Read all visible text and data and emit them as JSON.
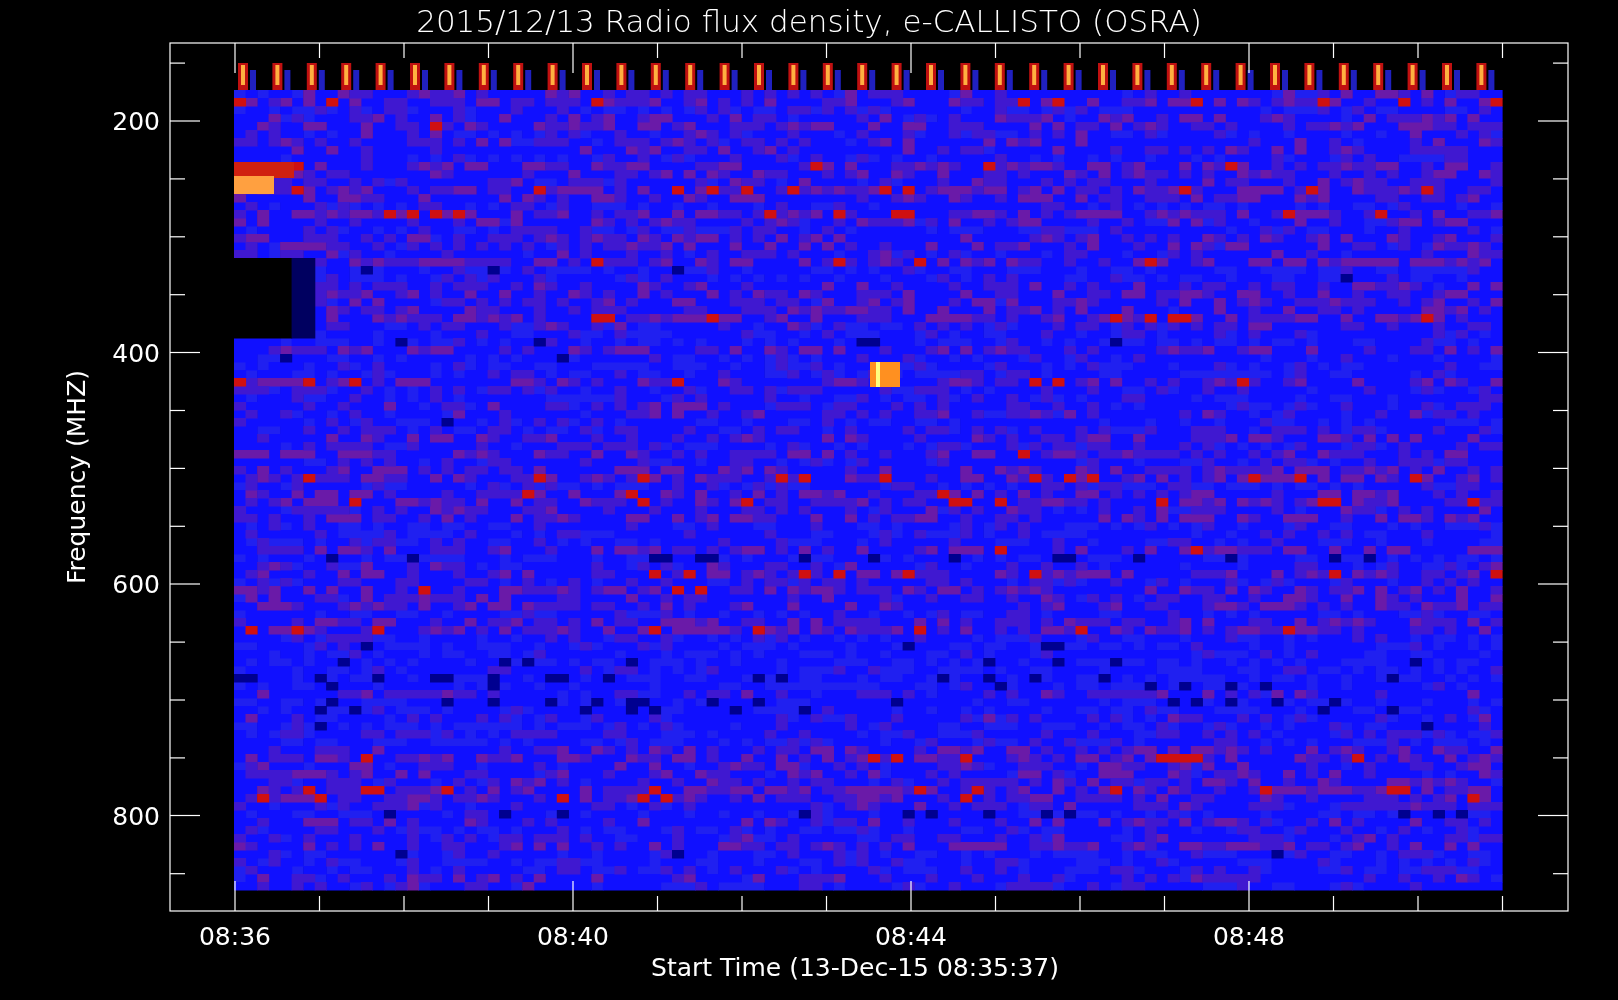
{
  "title": "2015/12/13  Radio flux density, e-CALLISTO (OSRA)",
  "y_axis": {
    "label": "Frequency (MHZ)",
    "ticks": [
      "200",
      "400",
      "600",
      "800"
    ]
  },
  "x_axis": {
    "label": "Start Time (13-Dec-15 08:35:37)",
    "ticks": [
      "08:36",
      "08:40",
      "08:44",
      "08:48"
    ]
  }
}
